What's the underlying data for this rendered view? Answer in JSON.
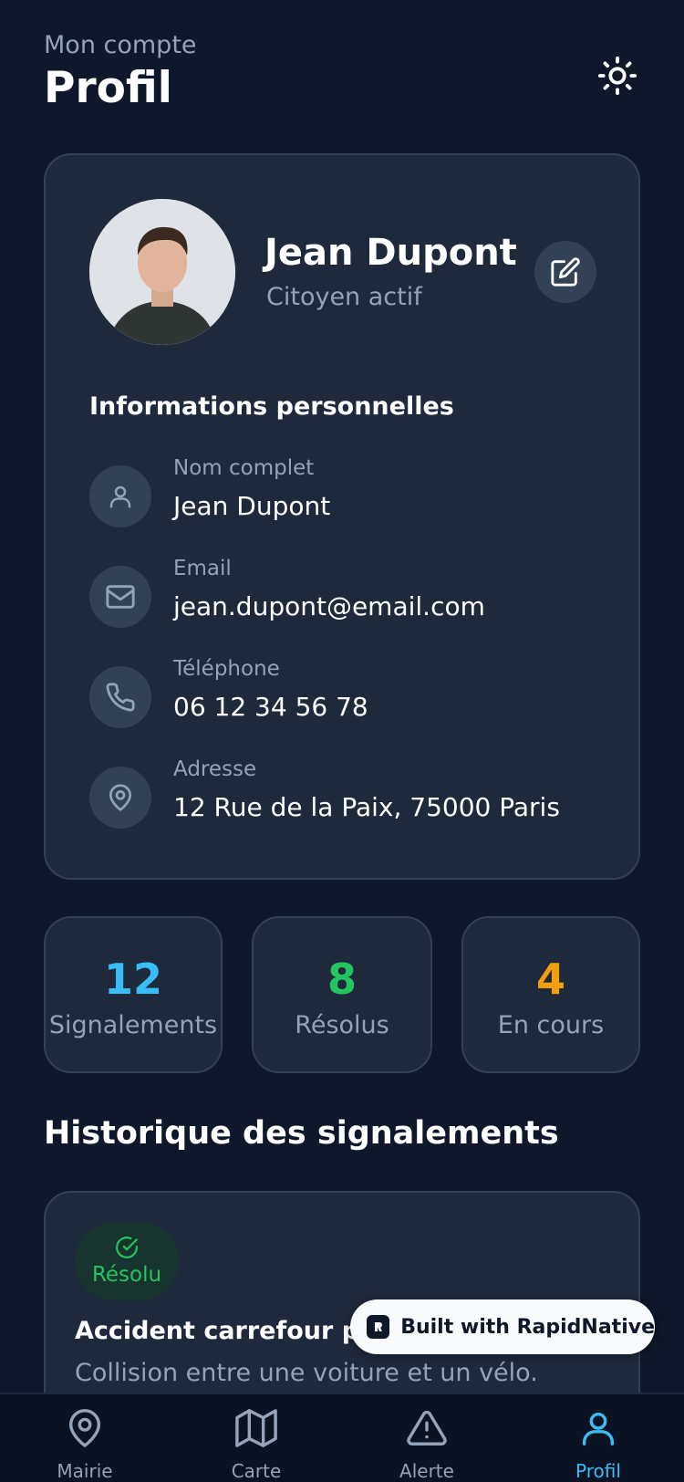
{
  "header": {
    "subtitle": "Mon compte",
    "title": "Profil"
  },
  "profile": {
    "name": "Jean Dupont",
    "role": "Citoyen actif",
    "section_title": "Informations personnelles",
    "info": [
      {
        "label": "Nom complet",
        "value": "Jean Dupont",
        "icon": "user-icon"
      },
      {
        "label": "Email",
        "value": "jean.dupont@email.com",
        "icon": "mail-icon"
      },
      {
        "label": "Téléphone",
        "value": "06 12 34 56 78",
        "icon": "phone-icon"
      },
      {
        "label": "Adresse",
        "value": "12 Rue de la Paix, 75000 Paris",
        "icon": "map-pin-icon"
      }
    ]
  },
  "stats": [
    {
      "value": "12",
      "label": "Signalements",
      "color": "#38bdf8"
    },
    {
      "value": "8",
      "label": "Résolus",
      "color": "#22c55e"
    },
    {
      "value": "4",
      "label": "En cours",
      "color": "#f59e0b"
    }
  ],
  "history": {
    "title": "Historique des signalements",
    "reports": [
      {
        "status": "Résolu",
        "title": "Accident carrefour pri",
        "description": "Collision entre une voiture et un vélo."
      }
    ]
  },
  "built_with": "Built with RapidNative",
  "tabs": [
    {
      "label": "Mairie",
      "icon": "map-pin-icon"
    },
    {
      "label": "Carte",
      "icon": "map-icon"
    },
    {
      "label": "Alerte",
      "icon": "alert-triangle-icon"
    },
    {
      "label": "Profil",
      "icon": "user-icon",
      "active": true
    }
  ],
  "colors": {
    "background": "#0f172a",
    "card": "#1e293b",
    "accent": "#38bdf8",
    "success": "#22c55e",
    "warning": "#f59e0b"
  }
}
